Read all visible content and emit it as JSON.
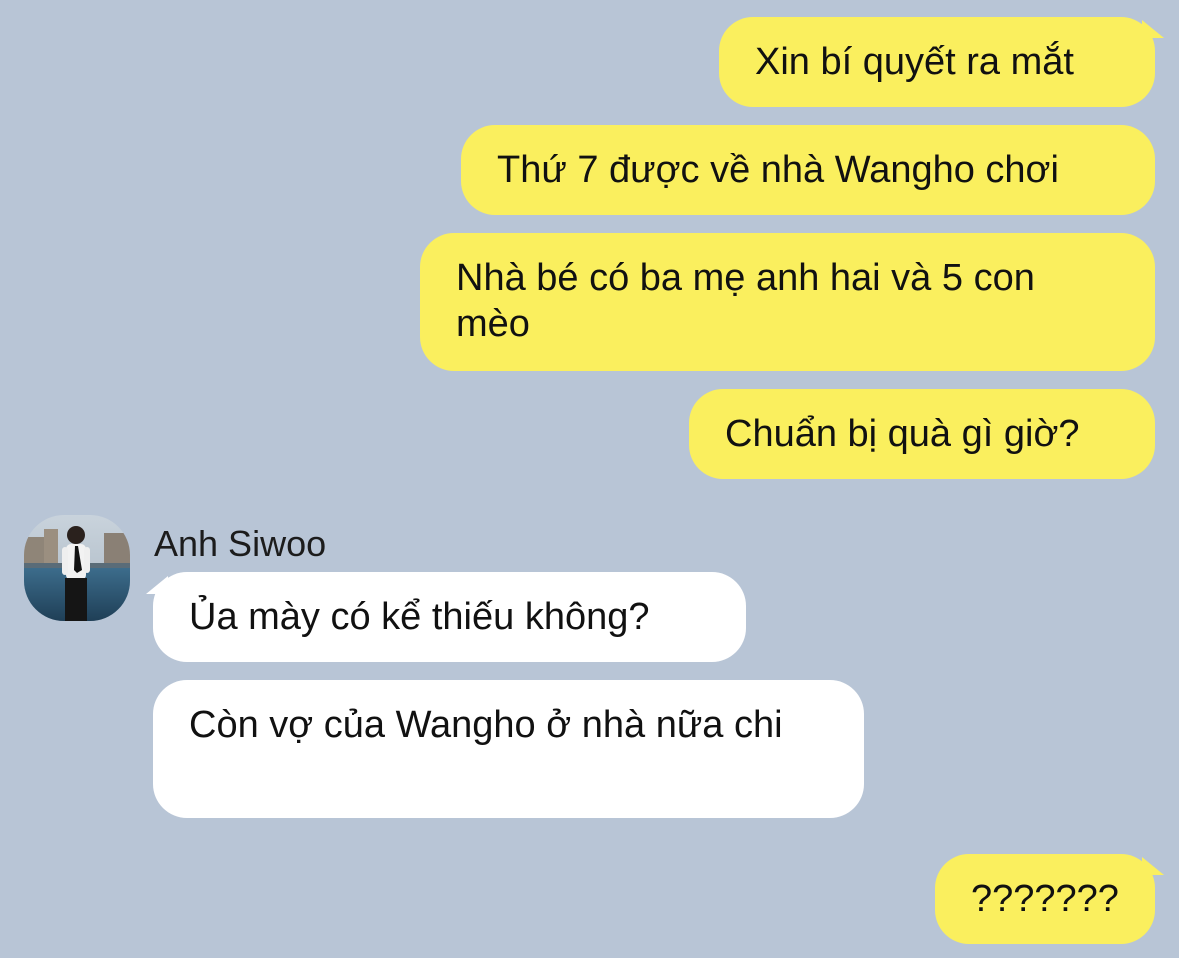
{
  "chat": {
    "outgoing": [
      {
        "text": "Xin bí quyết ra mắt"
      },
      {
        "text": "Thứ 7 được về nhà Wangho chơi"
      },
      {
        "text": "Nhà bé có ba mẹ anh hai và 5 con mèo"
      },
      {
        "text": "Chuẩn bị quà gì giờ?"
      },
      {
        "text": "???????"
      }
    ],
    "contact": {
      "name": "Anh Siwoo",
      "avatar_icon": "profile-photo"
    },
    "incoming": [
      {
        "text": "Ủa mày có kể thiếu không?"
      },
      {
        "text": "Còn vợ của Wangho ở nhà nữa chi"
      }
    ]
  },
  "colors": {
    "background": "#B8C5D6",
    "outgoing_bubble": "#FAEF5E",
    "incoming_bubble": "#FFFFFF",
    "text": "#111111"
  }
}
